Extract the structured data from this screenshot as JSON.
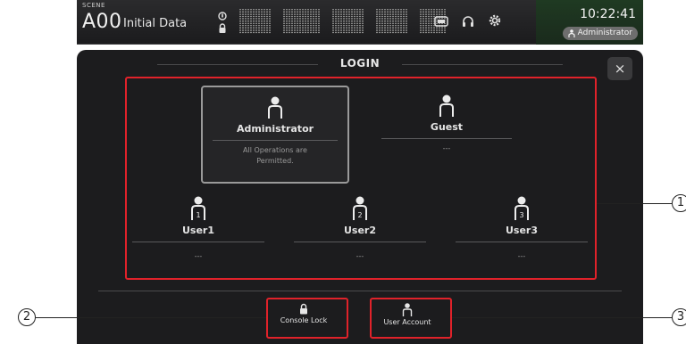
{
  "topbar": {
    "scene_label": "SCENE",
    "scene_number": "A00",
    "scene_title": "Initial Data",
    "clock": "10:22:41",
    "current_user": "Administrator",
    "icons": [
      "scene-info-icon",
      "lock-icon",
      "recorder-icon",
      "headphones-icon",
      "gear-icon"
    ]
  },
  "dialog": {
    "title": "LOGIN",
    "close_label": "×"
  },
  "users": [
    {
      "name": "Administrator",
      "desc_line1": "All Operations are",
      "desc_line2": "Permitted.",
      "number": ""
    },
    {
      "name": "Guest",
      "desc": "---",
      "number": ""
    },
    {
      "name": "User1",
      "desc": "---",
      "number": "1"
    },
    {
      "name": "User2",
      "desc": "---",
      "number": "2"
    },
    {
      "name": "User3",
      "desc": "---",
      "number": "3"
    }
  ],
  "footer": {
    "console_lock_label": "Console Lock",
    "user_account_label": "User Account"
  },
  "callouts": {
    "c1": "1",
    "c2": "2",
    "c3": "3"
  },
  "colors": {
    "highlight": "#e0222a",
    "panel": "#1c1c1e",
    "clock_bg": "#1f3a22"
  }
}
